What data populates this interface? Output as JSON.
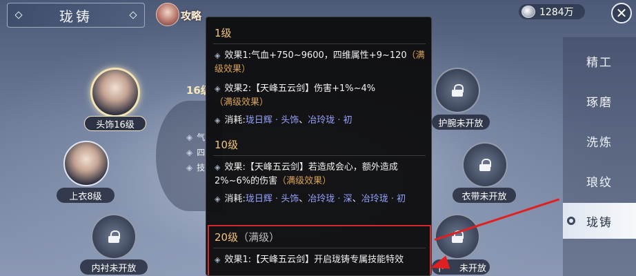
{
  "header": {
    "title": "珑铸",
    "guide_label": "攻略",
    "money": "1284万"
  },
  "slots": {
    "head": "头饰16级",
    "top": "上衣8级",
    "inner": "内衬未开放",
    "wrist": "护腕未开放",
    "belt": "衣带未开放",
    "boots_partial": "下",
    "boots_suffix": "未开放"
  },
  "center_peek": {
    "level": "16级",
    "line1": "气",
    "line2": "四",
    "line3": "技"
  },
  "tooltip": {
    "levels": [
      {
        "title": "1级",
        "effects": [
          {
            "bullet": "◈",
            "text": "效果1:气血+750~9600，四维属性+9~120",
            "note": "（满级效果）"
          },
          {
            "bullet": "◈",
            "text": "效果2:【天峰五云剑】伤害+1%~4%",
            "note": "（满级效果）"
          }
        ],
        "cost_label": "消耗:",
        "cost_items": [
          "珑日辉 · 头饰",
          "、",
          "冶玲珑 · 初"
        ]
      },
      {
        "title": "10级",
        "effects": [
          {
            "bullet": "◈",
            "text": "效果:【天峰五云剑】若造成会心，额外造成2%~6%的伤害",
            "note": "（满级效果）"
          }
        ],
        "cost_label": "消耗:",
        "cost_items": [
          "珑日辉 · 头饰",
          "、",
          "冶玲珑 · 深",
          "、",
          "冶玲珑 · 初"
        ]
      },
      {
        "title": "20级",
        "title_note": "（满级）",
        "effects": [
          {
            "bullet": "◈",
            "text": "效果1:【天峰五云剑】开启珑铸专属技能特效"
          }
        ]
      }
    ]
  },
  "side_tabs": [
    "精工",
    "琢磨",
    "洗炼",
    "琅纹",
    "珑铸"
  ],
  "active_tab": "珑铸",
  "colors": {
    "accent_gold": "#d9a24d",
    "item_blue": "#96a4ff",
    "highlight_red": "#d22a2a"
  }
}
